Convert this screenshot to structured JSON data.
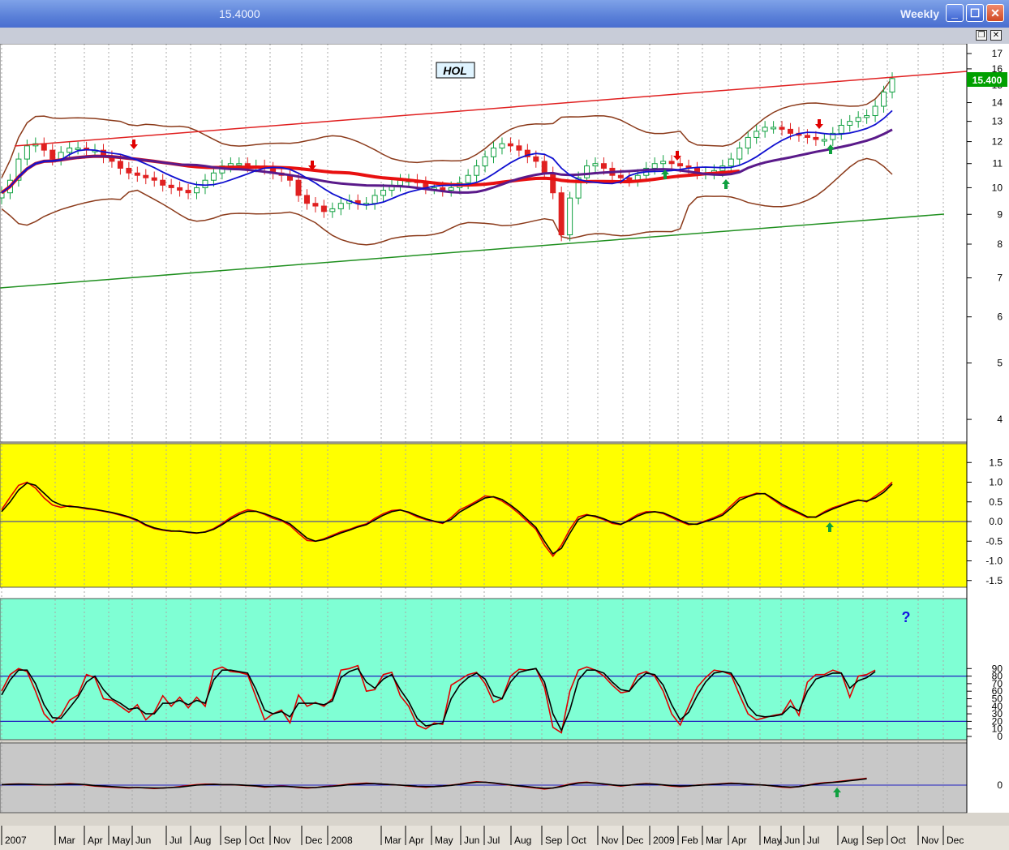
{
  "window": {
    "title": "15.4000",
    "timeframe": "Weekly"
  },
  "colors": {
    "panel_price_bg": "#ffffff",
    "panel_macd_bg": "#ffff00",
    "panel_stoch_bg": "#7fffd4",
    "panel_osc_bg": "#c8c8c8",
    "price_box": "#00a000",
    "upper_channel": "#e02020",
    "lower_channel": "#209020"
  },
  "chart_data": [
    {
      "type": "candlestick",
      "symbol": "HOL",
      "last_price": "15.400",
      "yscale": "log",
      "yticks": [
        "4",
        "5",
        "6",
        "7",
        "8",
        "9",
        "10",
        "11",
        "12",
        "13",
        "14",
        "15",
        "16",
        "17"
      ],
      "x_labels": [
        "2007",
        "Mar",
        "Apr",
        "May",
        "Jun",
        "Jul",
        "Aug",
        "Sep",
        "Oct",
        "Nov",
        "Dec",
        "2008",
        "Mar",
        "Apr",
        "May",
        "Jun",
        "Jul",
        "Aug",
        "Sep",
        "Oct",
        "Nov",
        "Dec",
        "2009",
        "Feb",
        "Mar",
        "Apr",
        "May",
        "Jun",
        "Jul",
        "Aug",
        "Sep",
        "Oct",
        "Nov",
        "Dec"
      ],
      "close": [
        9.8,
        10.3,
        11.2,
        11.8,
        11.9,
        11.6,
        11.2,
        11.5,
        11.7,
        11.7,
        11.6,
        11.6,
        11.3,
        11.1,
        10.8,
        10.6,
        10.5,
        10.4,
        10.3,
        10.1,
        10.0,
        9.9,
        9.8,
        10.0,
        10.3,
        10.6,
        10.9,
        11.0,
        11.0,
        10.9,
        10.9,
        10.8,
        10.6,
        10.5,
        10.3,
        9.7,
        9.4,
        9.3,
        9.1,
        9.2,
        9.4,
        9.5,
        9.4,
        9.4,
        9.7,
        9.9,
        10.1,
        10.3,
        10.3,
        10.2,
        10.0,
        10.0,
        9.9,
        10.0,
        10.2,
        10.5,
        10.9,
        11.3,
        11.7,
        11.9,
        11.8,
        11.6,
        11.3,
        11.1,
        10.6,
        9.8,
        8.3,
        9.6,
        10.4,
        10.9,
        11.0,
        10.8,
        10.5,
        10.4,
        10.3,
        10.5,
        10.8,
        11.0,
        11.1,
        11.0,
        10.9,
        10.8,
        10.6,
        10.6,
        10.7,
        10.9,
        11.2,
        11.7,
        12.2,
        12.5,
        12.7,
        12.7,
        12.6,
        12.4,
        12.3,
        12.2,
        12.1,
        12.1,
        12.4,
        12.8,
        13.0,
        13.2,
        13.3,
        13.8,
        14.6,
        15.4
      ],
      "indicators": [
        "EMA",
        "SMA",
        "SMA",
        "Bollinger Bands",
        "Trend channel",
        "Buy/Sell arrows"
      ]
    },
    {
      "type": "line",
      "yticks": [
        "1.5",
        "1.0",
        "0.5",
        "0.0",
        "-0.5",
        "-1.0",
        "-1.5"
      ],
      "series": [
        {
          "color": "#e00000",
          "values": [
            0.3,
            0.62,
            0.92,
            1.0,
            0.85,
            0.6,
            0.42,
            0.36,
            0.4,
            0.36,
            0.32,
            0.3,
            0.26,
            0.22,
            0.16,
            0.1,
            0.02,
            -0.1,
            -0.18,
            -0.22,
            -0.25,
            -0.24,
            -0.28,
            -0.3,
            -0.26,
            -0.18,
            -0.05,
            0.1,
            0.22,
            0.3,
            0.26,
            0.18,
            0.08,
            0.02,
            -0.1,
            -0.3,
            -0.48,
            -0.5,
            -0.44,
            -0.35,
            -0.26,
            -0.2,
            -0.12,
            -0.06,
            0.08,
            0.2,
            0.28,
            0.3,
            0.22,
            0.12,
            0.05,
            0.0,
            -0.05,
            0.1,
            0.3,
            0.4,
            0.52,
            0.65,
            0.62,
            0.52,
            0.38,
            0.2,
            0.0,
            -0.2,
            -0.6,
            -0.88,
            -0.6,
            -0.2,
            0.12,
            0.18,
            0.12,
            0.05,
            -0.05,
            -0.08,
            0.05,
            0.18,
            0.25,
            0.25,
            0.2,
            0.1,
            0.0,
            -0.08,
            -0.06,
            0.02,
            0.1,
            0.2,
            0.4,
            0.6,
            0.65,
            0.72,
            0.7,
            0.55,
            0.4,
            0.3,
            0.2,
            0.1,
            0.12,
            0.25,
            0.35,
            0.42,
            0.5,
            0.55,
            0.5,
            0.65,
            0.8,
            1.0
          ]
        },
        {
          "color": "#000000",
          "values": [
            0.25,
            0.5,
            0.8,
            0.98,
            0.92,
            0.72,
            0.52,
            0.42,
            0.38,
            0.37,
            0.34,
            0.31,
            0.27,
            0.23,
            0.18,
            0.12,
            0.04,
            -0.08,
            -0.16,
            -0.21,
            -0.24,
            -0.25,
            -0.27,
            -0.29,
            -0.27,
            -0.2,
            -0.08,
            0.06,
            0.18,
            0.26,
            0.26,
            0.2,
            0.12,
            0.04,
            -0.06,
            -0.24,
            -0.42,
            -0.5,
            -0.46,
            -0.38,
            -0.29,
            -0.22,
            -0.14,
            -0.08,
            0.04,
            0.16,
            0.25,
            0.29,
            0.24,
            0.15,
            0.07,
            0.01,
            -0.03,
            0.05,
            0.24,
            0.36,
            0.48,
            0.6,
            0.63,
            0.56,
            0.42,
            0.25,
            0.05,
            -0.15,
            -0.5,
            -0.82,
            -0.68,
            -0.3,
            0.05,
            0.16,
            0.14,
            0.07,
            -0.02,
            -0.07,
            0.02,
            0.14,
            0.22,
            0.25,
            0.22,
            0.13,
            0.03,
            -0.06,
            -0.07,
            0.0,
            0.07,
            0.16,
            0.34,
            0.54,
            0.63,
            0.7,
            0.71,
            0.58,
            0.44,
            0.33,
            0.23,
            0.12,
            0.11,
            0.22,
            0.32,
            0.4,
            0.48,
            0.54,
            0.52,
            0.6,
            0.74,
            0.95
          ]
        }
      ]
    },
    {
      "type": "line",
      "yticks": [
        "90",
        "80",
        "70",
        "60",
        "50",
        "40",
        "30",
        "20",
        "10",
        "0"
      ],
      "reference_lines": [
        80,
        20
      ],
      "annotation": "?",
      "series": [
        {
          "color": "#e00000",
          "values": [
            60,
            82,
            90,
            86,
            60,
            30,
            18,
            28,
            48,
            55,
            82,
            78,
            50,
            48,
            40,
            32,
            42,
            22,
            32,
            54,
            40,
            52,
            38,
            52,
            40,
            88,
            92,
            86,
            85,
            82,
            52,
            22,
            30,
            35,
            18,
            55,
            40,
            45,
            40,
            50,
            88,
            90,
            94,
            60,
            62,
            82,
            85,
            54,
            40,
            15,
            10,
            18,
            16,
            68,
            75,
            82,
            85,
            70,
            45,
            50,
            80,
            89,
            88,
            90,
            65,
            12,
            5,
            60,
            88,
            92,
            88,
            80,
            68,
            58,
            60,
            82,
            86,
            80,
            60,
            30,
            15,
            40,
            65,
            78,
            88,
            86,
            82,
            55,
            30,
            22,
            25,
            28,
            30,
            48,
            28,
            72,
            82,
            82,
            88,
            84,
            52,
            80,
            82,
            88
          ]
        },
        {
          "color": "#000000",
          "values": [
            55,
            75,
            88,
            88,
            70,
            42,
            25,
            24,
            38,
            52,
            72,
            80,
            62,
            50,
            44,
            36,
            38,
            30,
            30,
            44,
            44,
            48,
            42,
            48,
            44,
            75,
            88,
            88,
            86,
            84,
            62,
            35,
            30,
            33,
            26,
            44,
            44,
            44,
            42,
            47,
            78,
            86,
            90,
            72,
            64,
            76,
            82,
            62,
            46,
            24,
            14,
            16,
            18,
            50,
            68,
            78,
            84,
            76,
            54,
            50,
            72,
            85,
            88,
            90,
            72,
            30,
            8,
            35,
            75,
            88,
            88,
            84,
            72,
            62,
            60,
            74,
            84,
            82,
            68,
            42,
            22,
            32,
            54,
            72,
            84,
            86,
            84,
            66,
            40,
            28,
            26,
            27,
            29,
            40,
            34,
            60,
            76,
            80,
            84,
            84,
            64,
            74,
            78,
            86
          ]
        }
      ]
    },
    {
      "type": "line",
      "yticks": [
        "0"
      ],
      "series": [
        {
          "color": "#e00000",
          "values": [
            0.1,
            0.2,
            0.25,
            0.2,
            0.1,
            0.05,
            0.1,
            0.2,
            0.3,
            0.2,
            0.0,
            -0.2,
            -0.3,
            -0.4,
            -0.5,
            -0.6,
            -0.5,
            -0.6,
            -0.7,
            -0.6,
            -0.5,
            -0.3,
            -0.1,
            0.1,
            0.2,
            0.2,
            0.1,
            0.1,
            0.0,
            -0.1,
            -0.2,
            -0.4,
            -0.3,
            -0.2,
            -0.3,
            -0.5,
            -0.6,
            -0.5,
            -0.3,
            -0.2,
            0.0,
            0.2,
            0.3,
            0.4,
            0.3,
            0.2,
            0.1,
            0.0,
            -0.2,
            -0.3,
            -0.4,
            -0.3,
            -0.2,
            0.0,
            0.2,
            0.5,
            0.7,
            0.6,
            0.4,
            0.2,
            0.0,
            -0.2,
            -0.4,
            -0.6,
            -0.8,
            -0.6,
            -0.2,
            0.2,
            0.5,
            0.6,
            0.4,
            0.2,
            0.0,
            -0.2,
            0.0,
            0.2,
            0.3,
            0.2,
            0.0,
            -0.2,
            -0.3,
            -0.2,
            0.0,
            0.1,
            0.2,
            0.3,
            0.4,
            0.3,
            0.2,
            0.1,
            0.0,
            -0.2,
            -0.4,
            -0.5,
            -0.3,
            0.0,
            0.3,
            0.5,
            0.6,
            0.8,
            1.0,
            1.2,
            1.4
          ]
        },
        {
          "color": "#000000",
          "values": [
            0.1,
            0.15,
            0.2,
            0.2,
            0.15,
            0.1,
            0.1,
            0.15,
            0.2,
            0.2,
            0.1,
            -0.1,
            -0.2,
            -0.3,
            -0.4,
            -0.5,
            -0.5,
            -0.55,
            -0.6,
            -0.6,
            -0.5,
            -0.4,
            -0.2,
            0.0,
            0.1,
            0.15,
            0.1,
            0.1,
            0.05,
            -0.05,
            -0.15,
            -0.3,
            -0.3,
            -0.25,
            -0.3,
            -0.4,
            -0.5,
            -0.5,
            -0.35,
            -0.25,
            -0.1,
            0.1,
            0.2,
            0.3,
            0.3,
            0.2,
            0.1,
            0.0,
            -0.1,
            -0.25,
            -0.3,
            -0.3,
            -0.2,
            -0.05,
            0.15,
            0.4,
            0.6,
            0.6,
            0.45,
            0.25,
            0.05,
            -0.15,
            -0.3,
            -0.5,
            -0.65,
            -0.6,
            -0.3,
            0.1,
            0.4,
            0.5,
            0.4,
            0.25,
            0.05,
            -0.1,
            0.0,
            0.15,
            0.25,
            0.2,
            0.05,
            -0.1,
            -0.2,
            -0.15,
            -0.05,
            0.05,
            0.15,
            0.25,
            0.35,
            0.3,
            0.2,
            0.1,
            0.0,
            -0.15,
            -0.3,
            -0.4,
            -0.3,
            -0.05,
            0.2,
            0.4,
            0.55,
            0.7,
            0.9,
            1.1,
            1.3
          ]
        }
      ]
    }
  ]
}
